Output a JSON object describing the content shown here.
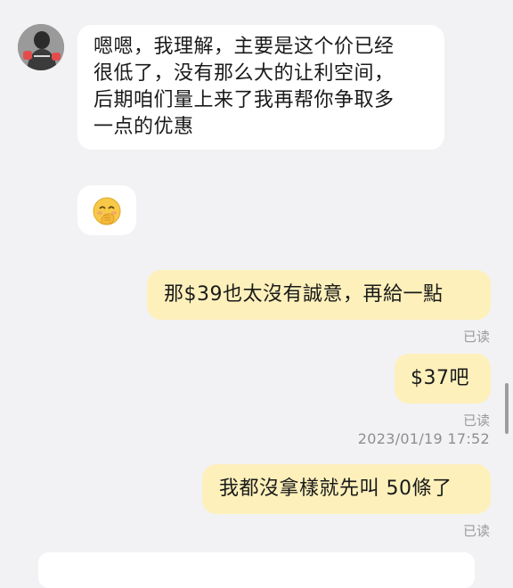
{
  "messages": [
    {
      "from": "other",
      "lines": [
        "嗯嗯，我理解，主要是这个价已经",
        "很低了，没有那么大的让利空间，",
        "后期咱们量上来了我再帮你争取多",
        "一点的优惠"
      ]
    },
    {
      "from": "other",
      "emoji": "hand-over-mouth-emoji"
    },
    {
      "from": "me",
      "text": "那$39也太沒有誠意，再給一點",
      "status": "已读"
    },
    {
      "from": "me",
      "text": "$37吧",
      "status": "已读"
    },
    {
      "from": "me",
      "text": "我都沒拿樣就先叫 50條了",
      "status": "已读"
    }
  ],
  "timestamp": "2023/01/19 17:52",
  "colors": {
    "background": "#f2f2f5",
    "incoming_bubble": "#ffffff",
    "outgoing_bubble": "#fdf0bb",
    "status_text": "#9a9a9a"
  }
}
